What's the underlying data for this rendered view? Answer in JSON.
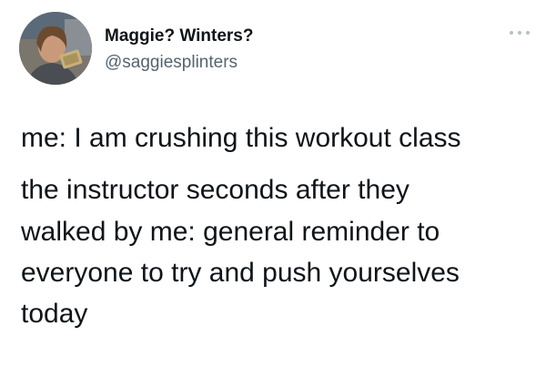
{
  "tweet": {
    "author": {
      "display_name": "Maggie? Winters?",
      "handle": "@saggiesplinters",
      "avatar_icon": "profile-photo"
    },
    "more_icon": "more-options-icon",
    "text_lines": [
      "me: I am crushing this workout class",
      "the instructor seconds after they",
      "walked by me: general reminder to",
      "everyone to try and push yourselves",
      "today"
    ]
  },
  "colors": {
    "text": "#0f1419",
    "secondary_text": "#536471",
    "background": "#ffffff"
  }
}
